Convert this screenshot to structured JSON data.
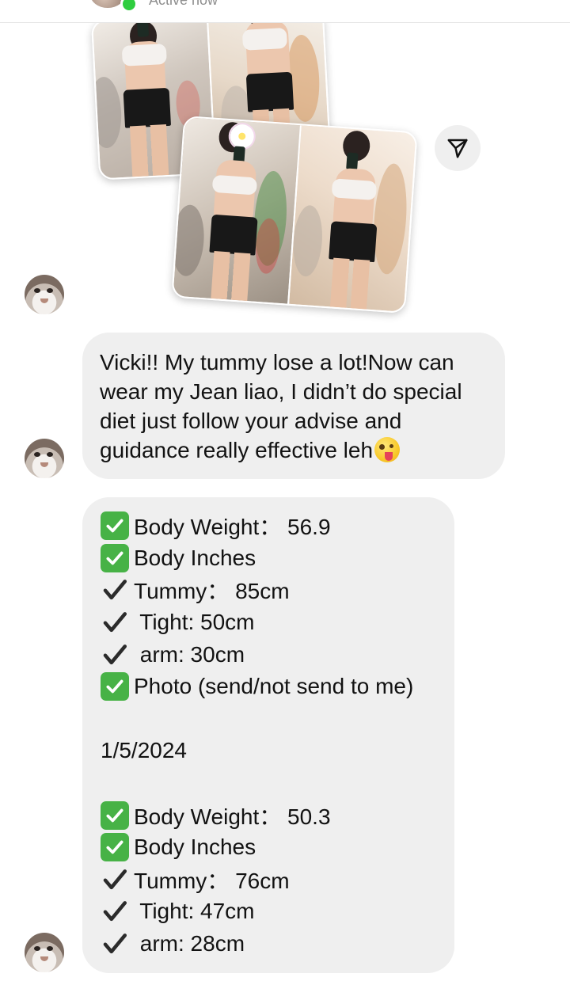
{
  "header": {
    "status_text": "Active now",
    "active_color": "#2fcd3f"
  },
  "photos": {
    "back_card_icon": "progress-photo-before",
    "front_card_icon": "progress-photo-after"
  },
  "share": {
    "icon": "send-icon"
  },
  "messages": [
    {
      "sender": "contact",
      "text": "Vicki!! My tummy lose a lot!Now can wear my Jean liao, I didn’t do special diet just follow your advise and guidance really effective leh",
      "emoji": "winking-face-with-tongue"
    }
  ],
  "checklist": {
    "lines": [
      {
        "marker": "green-check",
        "text": "Body Weight： 56.9"
      },
      {
        "marker": "green-check",
        "text": "Body Inches"
      },
      {
        "marker": "check",
        "text": "Tummy： 85cm"
      },
      {
        "marker": "check",
        "text": " Tight: 50cm"
      },
      {
        "marker": "check",
        "text": " arm: 30cm"
      },
      {
        "marker": "green-check",
        "text": "Photo (send/not send to me)"
      },
      {
        "marker": "none",
        "text": ""
      },
      {
        "marker": "none",
        "text": "1/5/2024"
      },
      {
        "marker": "none",
        "text": ""
      },
      {
        "marker": "green-check",
        "text": "Body Weight： 50.3"
      },
      {
        "marker": "green-check",
        "text": "Body Inches"
      },
      {
        "marker": "check",
        "text": "Tummy： 76cm"
      },
      {
        "marker": "check",
        "text": " Tight: 47cm"
      },
      {
        "marker": "check",
        "text": " arm: 28cm"
      }
    ]
  },
  "colors": {
    "bubble": "#efefef",
    "green_check": "#47b246",
    "text": "#121212"
  }
}
